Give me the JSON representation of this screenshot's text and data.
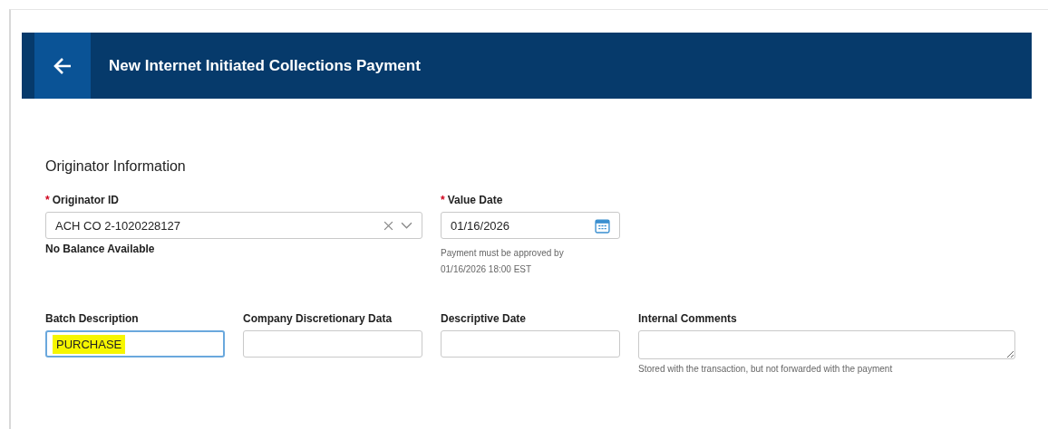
{
  "header": {
    "title": "New Internet Initiated Collections Payment"
  },
  "section": {
    "title": "Originator Information"
  },
  "row1": [
    {
      "kind": "select",
      "label": "Originator ID",
      "required_mark": "*",
      "value": "ACH CO 2-1020228127",
      "note": "No Balance Available"
    },
    {
      "kind": "date",
      "label": "Value Date",
      "required_mark": "*",
      "value": "01/16/2026",
      "hint": "Payment must be approved by 01/16/2026 18:00 EST"
    }
  ],
  "row2": [
    {
      "kind": "text",
      "label": "Batch Description",
      "value": "PURCHASE",
      "focused": true,
      "highlighted": true
    },
    {
      "kind": "text",
      "label": "Company Discretionary Data",
      "focused": false
    },
    {
      "kind": "text",
      "label": "Descriptive Date",
      "focused": false
    },
    {
      "kind": "textarea",
      "label": "Internal Comments",
      "hint": "Stored with the transaction, but not forwarded with the payment",
      "focused": false
    }
  ]
}
